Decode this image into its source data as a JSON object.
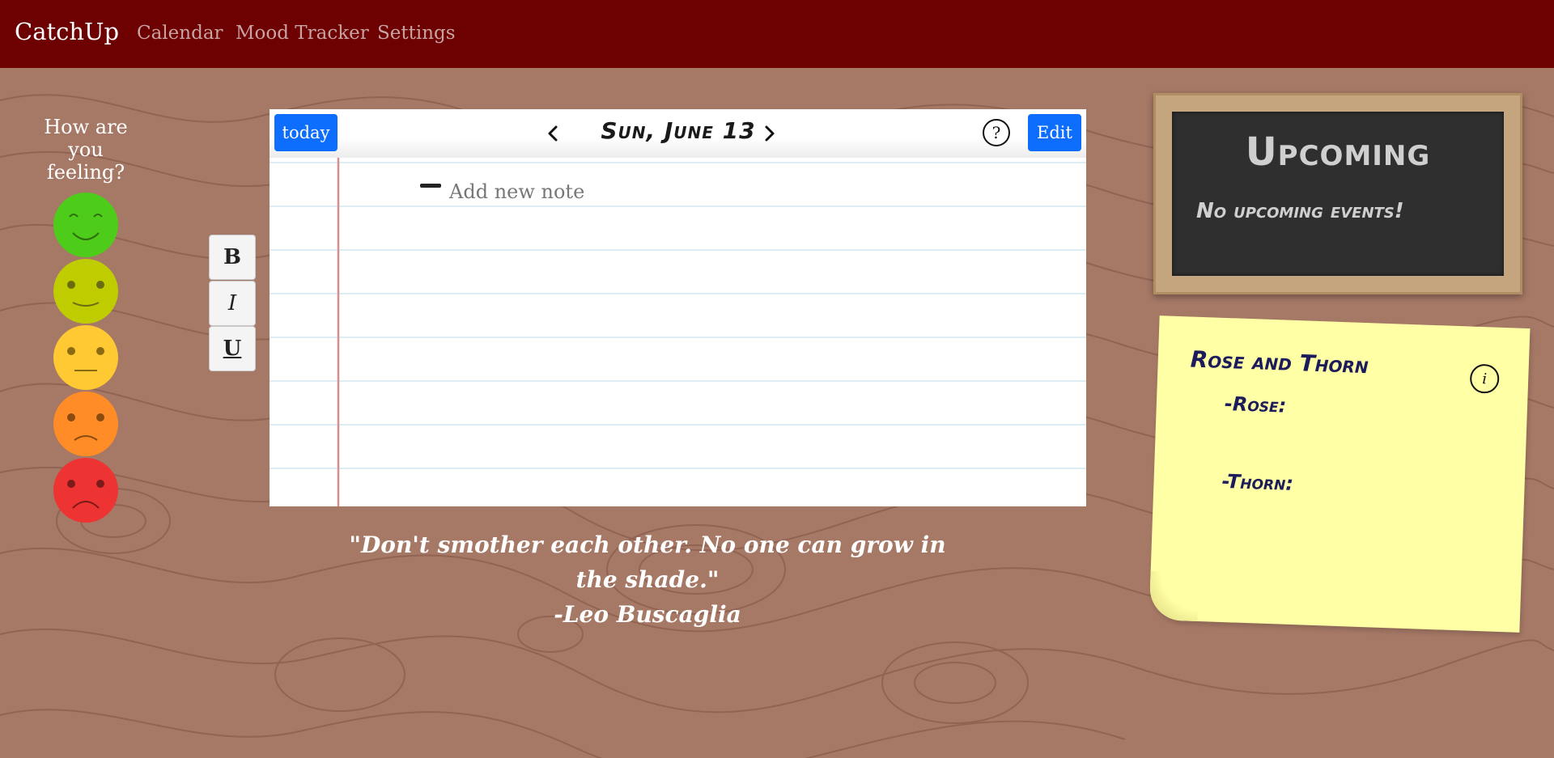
{
  "navbar": {
    "brand": "CatchUp",
    "links": [
      "Calendar",
      "Mood Tracker",
      "Settings"
    ]
  },
  "mood": {
    "question": "How are you feeling?",
    "faces": [
      {
        "name": "very-happy",
        "color": "#4dcc1a"
      },
      {
        "name": "happy",
        "color": "#bfcc00"
      },
      {
        "name": "neutral",
        "color": "#ffc933"
      },
      {
        "name": "sad",
        "color": "#ff8c26"
      },
      {
        "name": "very-sad",
        "color": "#ee3333"
      }
    ]
  },
  "format_buttons": {
    "bold": "B",
    "italic": "I",
    "underline": "U"
  },
  "notebook": {
    "today_label": "today",
    "date": "Sun, June 13",
    "help_label": "?",
    "edit_label": "Edit",
    "add_note_label": "Add new note"
  },
  "quote": {
    "text": "\"Don't smother each other. No one can grow in the shade.\"",
    "author": "-Leo Buscaglia"
  },
  "upcoming": {
    "title": "Upcoming",
    "empty_text": "No upcoming events!"
  },
  "sticky": {
    "title": "Rose and Thorn",
    "rose_label": "-Rose:",
    "thorn_label": "-Thorn:",
    "info_label": "i"
  },
  "colors": {
    "navbar": "#6d0000",
    "background": "#a67866",
    "accent_blue": "#0d6efd",
    "chalkboard": "#2f2f2f",
    "sticky": "#ffffa5"
  }
}
